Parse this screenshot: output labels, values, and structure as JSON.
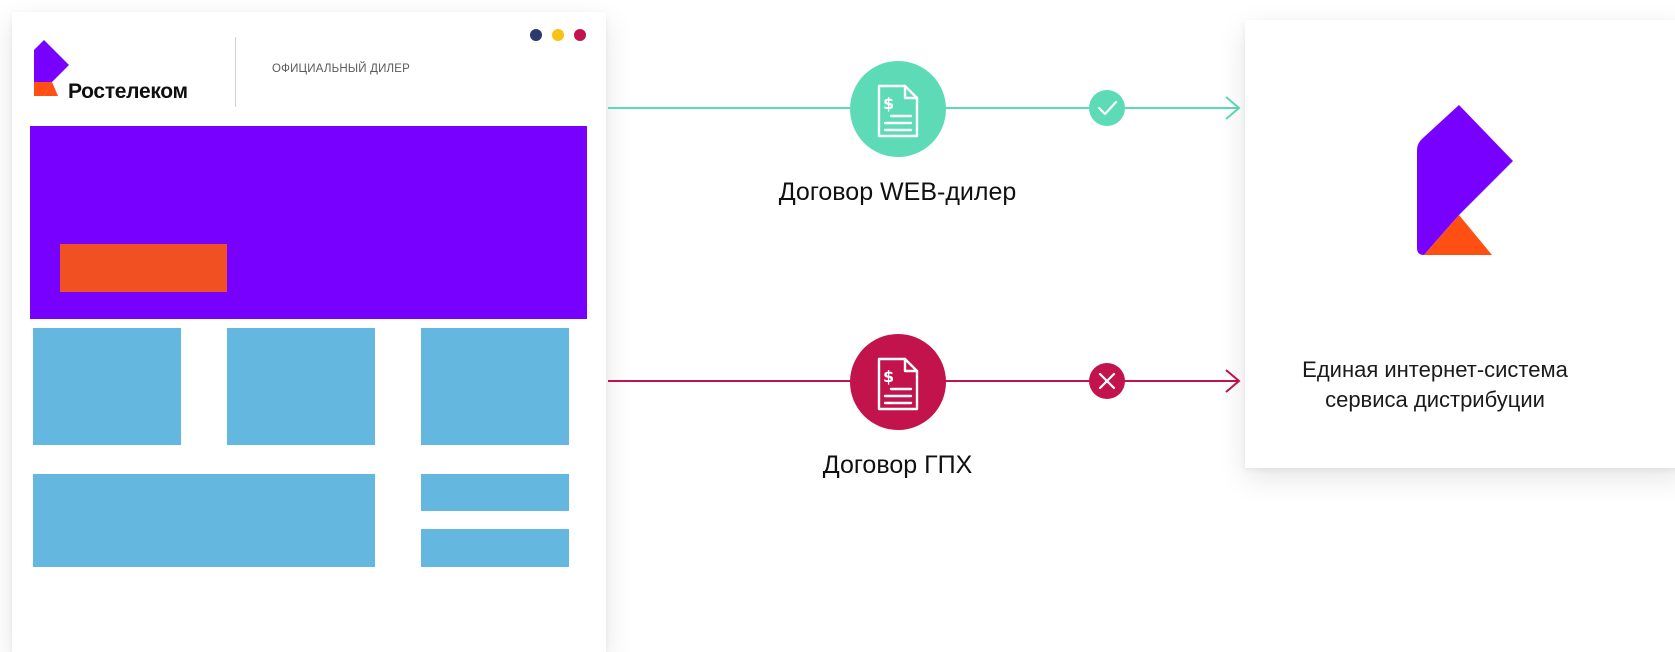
{
  "dealer_site": {
    "brand_name": "Ростелеком",
    "dealer_label": "ОФИЦИАЛЬНЫЙ ДИЛЕР",
    "window_dots": [
      {
        "name": "dot-navy",
        "color": "#2b3a6b"
      },
      {
        "name": "dot-yellow",
        "color": "#f8c210"
      },
      {
        "name": "dot-crimson",
        "color": "#c2134c"
      }
    ],
    "colors": {
      "banner": "#7700ff",
      "button": "#f05022",
      "tiles": "#64b7df",
      "logo_purple": "#7700ff",
      "logo_orange": "#ff4f12"
    }
  },
  "flows": {
    "web_dealer": {
      "label": "Договор WEB-дилер",
      "status": "allowed",
      "status_icon": "check-icon",
      "document_icon": "contract-document-icon",
      "color": "#5cdbb6"
    },
    "gph": {
      "label": "Договор ГПХ",
      "status": "denied",
      "status_icon": "cross-icon",
      "document_icon": "contract-document-icon",
      "color": "#c2134c"
    }
  },
  "system": {
    "caption": "Единая интернет-система сервиса дистрибуции"
  }
}
